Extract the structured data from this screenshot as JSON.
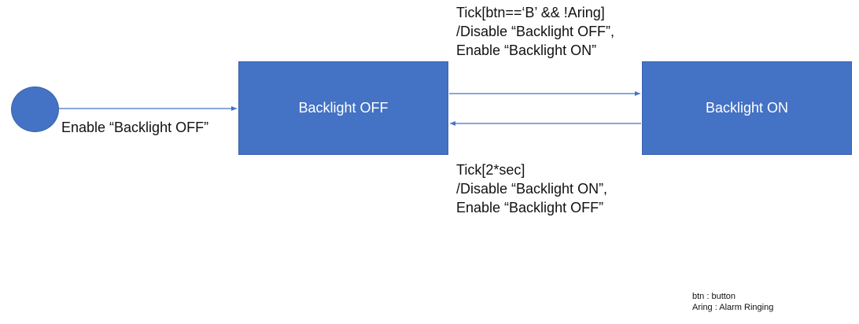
{
  "states": {
    "off_label": "Backlight OFF",
    "on_label": "Backlight ON"
  },
  "transitions": {
    "initial": {
      "label": "Enable “Backlight OFF”"
    },
    "off_to_on": {
      "lines": [
        "Tick[btn==‘B’ && !Aring]",
        "/Disable “Backlight OFF”,",
        "Enable “Backlight ON”"
      ]
    },
    "on_to_off": {
      "lines": [
        "Tick[2*sec]",
        "/Disable “Backlight ON”,",
        "Enable “Backlight OFF”"
      ]
    }
  },
  "legend": {
    "lines": [
      "btn : button",
      "Aring : Alarm Ringing"
    ]
  },
  "colors": {
    "state_fill": "#4472C4",
    "edge": "#4472C4",
    "text": "#111111",
    "state_text": "#ffffff"
  }
}
